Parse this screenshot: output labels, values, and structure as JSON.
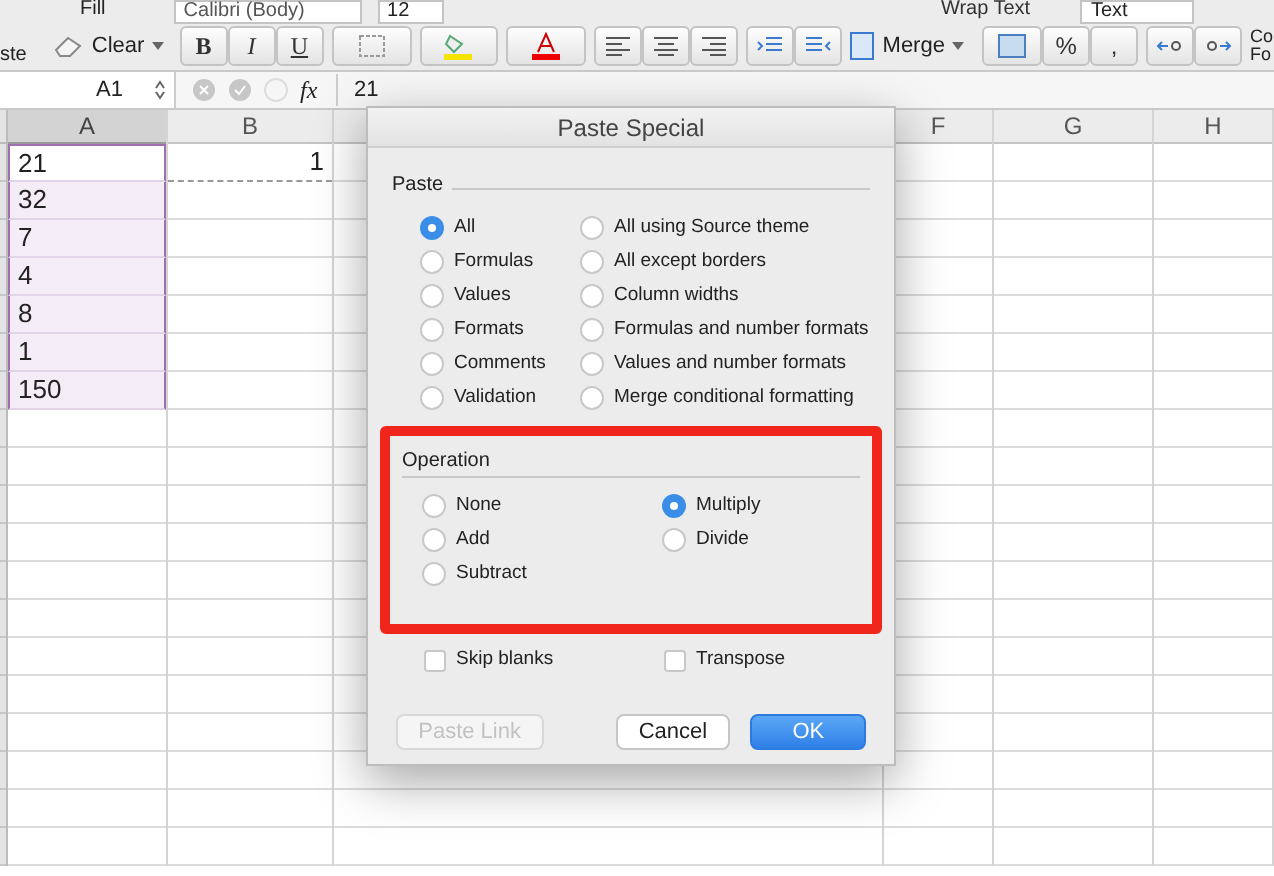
{
  "ribbon": {
    "paste_label": "ste",
    "fill_label": "Fill",
    "clear_label": "Clear",
    "font": "Calibri (Body)",
    "size": "12",
    "bold": "B",
    "italic": "I",
    "underline": "U",
    "wrap_text": "Wrap Text",
    "number_format": "Text",
    "merge": "Merge",
    "percent": "%",
    "comma": ",",
    "cond_format_label": "Co Fo"
  },
  "formula_bar": {
    "name_box": "A1",
    "fx": "fx",
    "value": "21"
  },
  "columns": [
    {
      "label": "A",
      "selected": true
    },
    {
      "label": "B",
      "selected": false
    },
    {
      "label": "F",
      "selected": false
    },
    {
      "label": "G",
      "selected": false
    },
    {
      "label": "H",
      "selected": false
    }
  ],
  "rows": [
    {
      "a": {
        "text": "21",
        "selected": true
      },
      "b": {
        "text": "1",
        "copied": true
      }
    },
    {
      "a": {
        "text": "32",
        "selected": true
      }
    },
    {
      "a": {
        "text": "7",
        "selected": true
      }
    },
    {
      "a": {
        "text": "4",
        "selected": true
      }
    },
    {
      "a": {
        "text": "8",
        "selected": true
      }
    },
    {
      "a": {
        "text": "1",
        "selected": true
      }
    },
    {
      "a": {
        "text": "150",
        "selected": true
      }
    }
  ],
  "dialog": {
    "title": "Paste Special",
    "paste": {
      "label": "Paste",
      "options": [
        {
          "label": "All",
          "selected": true
        },
        {
          "label": "Formulas",
          "selected": false
        },
        {
          "label": "Values",
          "selected": false
        },
        {
          "label": "Formats",
          "selected": false
        },
        {
          "label": "Comments",
          "selected": false
        },
        {
          "label": "Validation",
          "selected": false
        },
        {
          "label": "All using Source theme",
          "selected": false
        },
        {
          "label": "All except borders",
          "selected": false
        },
        {
          "label": "Column widths",
          "selected": false
        },
        {
          "label": "Formulas and number formats",
          "selected": false
        },
        {
          "label": "Values and number formats",
          "selected": false
        },
        {
          "label": "Merge conditional formatting",
          "selected": false
        }
      ]
    },
    "operation": {
      "label": "Operation",
      "highlighted": true,
      "options": [
        {
          "label": "None",
          "selected": false
        },
        {
          "label": "Add",
          "selected": false
        },
        {
          "label": "Subtract",
          "selected": false
        },
        {
          "label": "Multiply",
          "selected": true
        },
        {
          "label": "Divide",
          "selected": false
        }
      ]
    },
    "checkboxes": [
      {
        "label": "Skip blanks",
        "checked": false
      },
      {
        "label": "Transpose",
        "checked": false
      }
    ],
    "buttons": [
      {
        "label": "Paste Link",
        "kind": "secondary",
        "disabled": true
      },
      {
        "label": "Cancel",
        "kind": "secondary",
        "disabled": false
      },
      {
        "label": "OK",
        "kind": "default",
        "disabled": false
      }
    ]
  }
}
